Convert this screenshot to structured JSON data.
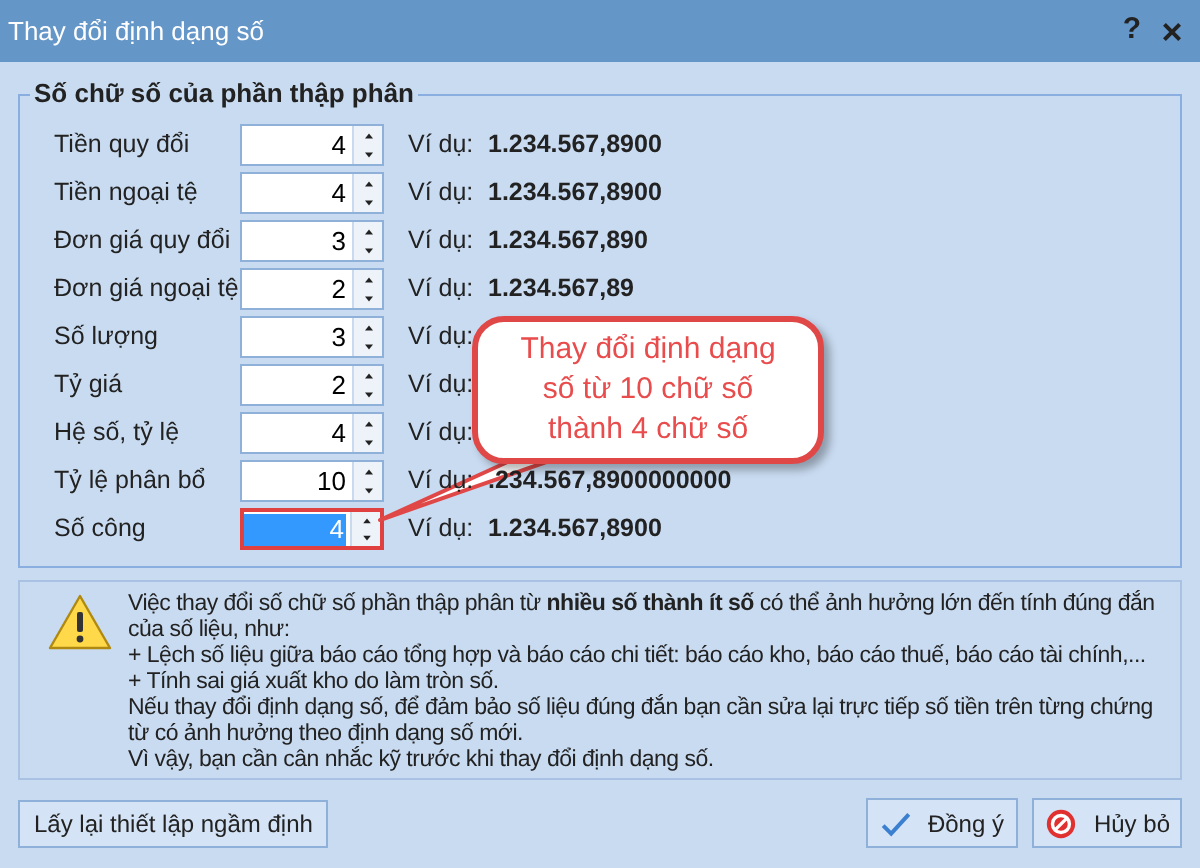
{
  "window": {
    "title": "Thay đổi định dạng số",
    "help": "?",
    "close": "×"
  },
  "group": {
    "title": "Số chữ số của phần thập phân",
    "rows": [
      {
        "label": "Tiền quy đổi",
        "value": "4",
        "example_label": "Ví dụ:",
        "example": "1.234.567,8900",
        "selected": false
      },
      {
        "label": "Tiền ngoại tệ",
        "value": "4",
        "example_label": "Ví dụ:",
        "example": "1.234.567,8900",
        "selected": false
      },
      {
        "label": "Đơn giá quy đổi",
        "value": "3",
        "example_label": "Ví dụ:",
        "example": "1.234.567,890",
        "selected": false
      },
      {
        "label": "Đơn giá ngoại tệ",
        "value": "2",
        "example_label": "Ví dụ:",
        "example": "1.234.567,89",
        "selected": false
      },
      {
        "label": "Số lượng",
        "value": "3",
        "example_label": "Ví dụ:",
        "selected": false
      },
      {
        "label": "Tỷ giá",
        "value": "2",
        "example_label": "Ví dụ:",
        "selected": false
      },
      {
        "label": "Hệ số, tỷ lệ",
        "value": "4",
        "example_label": "Ví dụ:",
        "selected": false
      },
      {
        "label": "Tỷ lệ phân bổ",
        "value": "10",
        "example_label": "Ví dụ:",
        "example": ".234.567,8900000000",
        "selected": false
      },
      {
        "label": "Số công",
        "value": "4",
        "example_label": "Ví dụ:",
        "example": "1.234.567,8900",
        "selected": true
      }
    ]
  },
  "callout": {
    "lines": [
      "Thay đổi định dạng",
      "số từ 10 chữ số",
      "thành 4 chữ số"
    ]
  },
  "warning": {
    "lines": [
      "Việc thay đổi số chữ số phần thập phân từ **nhiều số thành ít số** có thể ảnh hưởng lớn đến tính đúng đắn của số liệu, như:",
      "+ Lệch số liệu giữa báo cáo tổng hợp và báo cáo chi tiết: báo cáo kho, báo cáo thuế, báo cáo tài chính,...",
      "+ Tính sai giá xuất kho do làm tròn số.",
      "Nếu thay đổi định dạng số, để đảm bảo số liệu đúng đắn bạn cần sửa lại trực tiếp số tiền trên từng chứng từ có ảnh hưởng theo định dạng số mới.",
      "Vì vậy, bạn cần cân nhắc kỹ trước khi thay đổi định dạng số."
    ]
  },
  "buttons": {
    "reset": "Lấy lại thiết lập ngầm định",
    "ok": "Đồng ý",
    "cancel": "Hủy bỏ"
  }
}
